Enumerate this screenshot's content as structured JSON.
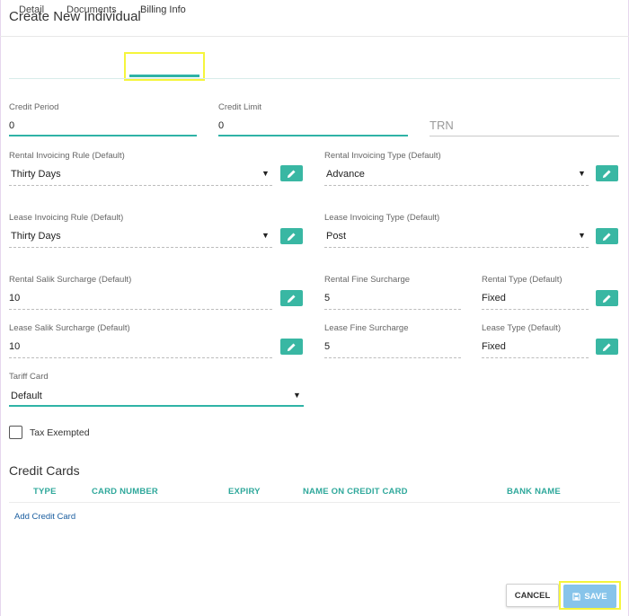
{
  "dialog": {
    "title": "Create New Individual"
  },
  "tabs": [
    {
      "label": "Detail"
    },
    {
      "label": "Documents"
    },
    {
      "label": "Billing Info"
    }
  ],
  "billing": {
    "credit_period": {
      "label": "Credit Period",
      "value": "0"
    },
    "credit_limit": {
      "label": "Credit Limit",
      "value": "0"
    },
    "trn": {
      "placeholder": "TRN"
    },
    "rental_invoicing_rule": {
      "label": "Rental Invoicing Rule (Default)",
      "value": "Thirty Days"
    },
    "rental_invoicing_type": {
      "label": "Rental Invoicing Type (Default)",
      "value": "Advance"
    },
    "lease_invoicing_rule": {
      "label": "Lease Invoicing Rule (Default)",
      "value": "Thirty Days"
    },
    "lease_invoicing_type": {
      "label": "Lease Invoicing Type (Default)",
      "value": "Post"
    },
    "rental_salik_surcharge": {
      "label": "Rental Salik Surcharge (Default)",
      "value": "10"
    },
    "rental_fine_surcharge": {
      "label": "Rental Fine Surcharge",
      "value": "5"
    },
    "rental_type": {
      "label": "Rental Type (Default)",
      "value": "Fixed"
    },
    "lease_salik_surcharge": {
      "label": "Lease Salik Surcharge (Default)",
      "value": "10"
    },
    "lease_fine_surcharge": {
      "label": "Lease Fine Surcharge",
      "value": "5"
    },
    "lease_type": {
      "label": "Lease Type (Default)",
      "value": "Fixed"
    },
    "tariff_card": {
      "label": "Tariff Card",
      "value": "Default"
    },
    "tax_exempted": {
      "label": "Tax Exempted",
      "checked": false
    }
  },
  "credit_cards": {
    "title": "Credit Cards",
    "columns": [
      "TYPE",
      "CARD NUMBER",
      "EXPIRY",
      "NAME ON CREDIT CARD",
      "BANK NAME"
    ],
    "add_link": "Add Credit Card"
  },
  "footer": {
    "cancel_label": "CANCEL",
    "save_label": "SAVE"
  },
  "icons": {
    "dropdown": "caret-down-icon",
    "edit": "pencil-icon",
    "save": "floppy-disk-icon"
  },
  "colors": {
    "accent": "#2fb3a6",
    "edit_button": "#39b7a3",
    "save_button": "#87c4ea",
    "link": "#1c5fa0",
    "highlight": "#f5f53c"
  }
}
